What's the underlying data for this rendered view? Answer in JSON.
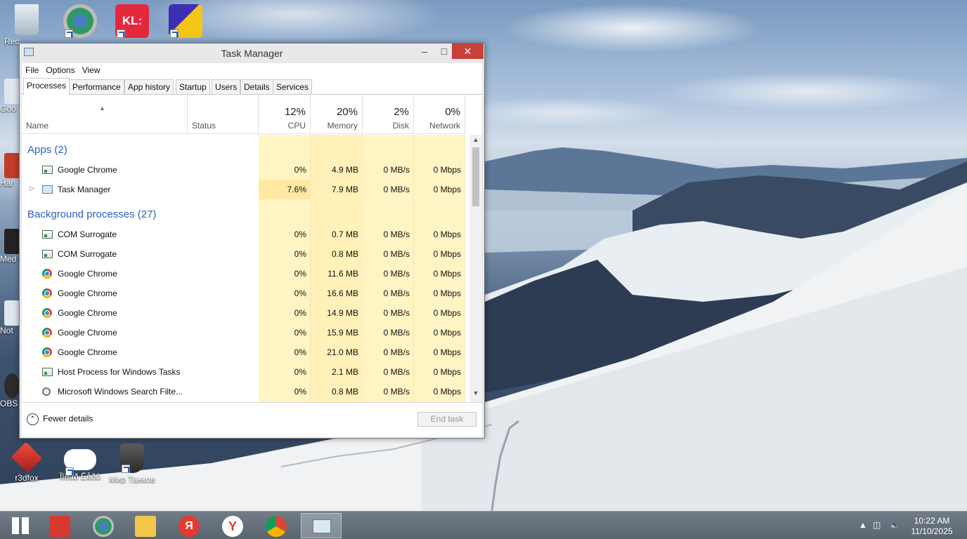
{
  "desktop": {
    "icons": [
      {
        "label": "Rec",
        "name": "recycle-bin"
      },
      {
        "label": "",
        "name": "browser-shortcut"
      },
      {
        "label": "",
        "name": "kaspersky-shortcut"
      },
      {
        "label": "",
        "name": "game-shortcut"
      }
    ],
    "edge_labels": [
      "Goo",
      "Har",
      "Med\nC",
      "Not",
      "OBS"
    ],
    "bottom_icons": [
      {
        "label": "r3dfox"
      },
      {
        "label": "Ïîêåð Ëåðû"
      },
      {
        "label": "Мир Танков"
      }
    ]
  },
  "window": {
    "title": "Task Manager",
    "menu": [
      "File",
      "Options",
      "View"
    ],
    "tabs": [
      "Processes",
      "Performance",
      "App history",
      "Startup",
      "Users",
      "Details",
      "Services"
    ],
    "active_tab": "Processes",
    "columns": {
      "name": "Name",
      "status": "Status",
      "cpu": {
        "pct": "12%",
        "label": "CPU"
      },
      "memory": {
        "pct": "20%",
        "label": "Memory"
      },
      "disk": {
        "pct": "2%",
        "label": "Disk"
      },
      "network": {
        "pct": "0%",
        "label": "Network"
      }
    },
    "groups": [
      {
        "title": "Apps (2)",
        "rows": [
          {
            "icon": "app-window-icon",
            "name": "Google Chrome",
            "cpu": "0%",
            "memory": "4.9 MB",
            "disk": "0 MB/s",
            "network": "0 Mbps",
            "expandable": false
          },
          {
            "icon": "task-manager-icon",
            "name": "Task Manager",
            "cpu": "7.6%",
            "memory": "7.9 MB",
            "disk": "0 MB/s",
            "network": "0 Mbps",
            "expandable": true
          }
        ]
      },
      {
        "title": "Background processes (27)",
        "rows": [
          {
            "icon": "app-window-icon",
            "name": "COM Surrogate",
            "cpu": "0%",
            "memory": "0.7 MB",
            "disk": "0 MB/s",
            "network": "0 Mbps"
          },
          {
            "icon": "app-window-icon",
            "name": "COM Surrogate",
            "cpu": "0%",
            "memory": "0.8 MB",
            "disk": "0 MB/s",
            "network": "0 Mbps"
          },
          {
            "icon": "chrome-icon",
            "name": "Google Chrome",
            "cpu": "0%",
            "memory": "11.6 MB",
            "disk": "0 MB/s",
            "network": "0 Mbps"
          },
          {
            "icon": "chrome-icon",
            "name": "Google Chrome",
            "cpu": "0%",
            "memory": "16.6 MB",
            "disk": "0 MB/s",
            "network": "0 Mbps"
          },
          {
            "icon": "chrome-icon",
            "name": "Google Chrome",
            "cpu": "0%",
            "memory": "14.9 MB",
            "disk": "0 MB/s",
            "network": "0 Mbps"
          },
          {
            "icon": "chrome-icon",
            "name": "Google Chrome",
            "cpu": "0%",
            "memory": "15.9 MB",
            "disk": "0 MB/s",
            "network": "0 Mbps"
          },
          {
            "icon": "chrome-icon",
            "name": "Google Chrome",
            "cpu": "0%",
            "memory": "21.0 MB",
            "disk": "0 MB/s",
            "network": "0 Mbps"
          },
          {
            "icon": "app-window-icon",
            "name": "Host Process for Windows Tasks",
            "cpu": "0%",
            "memory": "2.1 MB",
            "disk": "0 MB/s",
            "network": "0 Mbps"
          },
          {
            "icon": "search-filter-icon",
            "name": "Microsoft Windows Search Filte...",
            "cpu": "0%",
            "memory": "0.8 MB",
            "disk": "0 MB/s",
            "network": "0 Mbps"
          }
        ]
      }
    ],
    "footer": {
      "fewer_details": "Fewer details",
      "end_task": "End task"
    }
  },
  "taskbar": {
    "apps": [
      "start",
      "r3dfox",
      "browser",
      "file-explorer",
      "yandex",
      "yandex-browser",
      "chrome",
      "task-manager"
    ],
    "active_app": "task-manager",
    "time": "10:22 AM",
    "date": "11/10/2025"
  },
  "colors": {
    "accent": "#2a63b8",
    "close_button": "#c7403a",
    "cpu_highlight": "#fff4c4",
    "memory_highlight": "#fff1b8"
  }
}
